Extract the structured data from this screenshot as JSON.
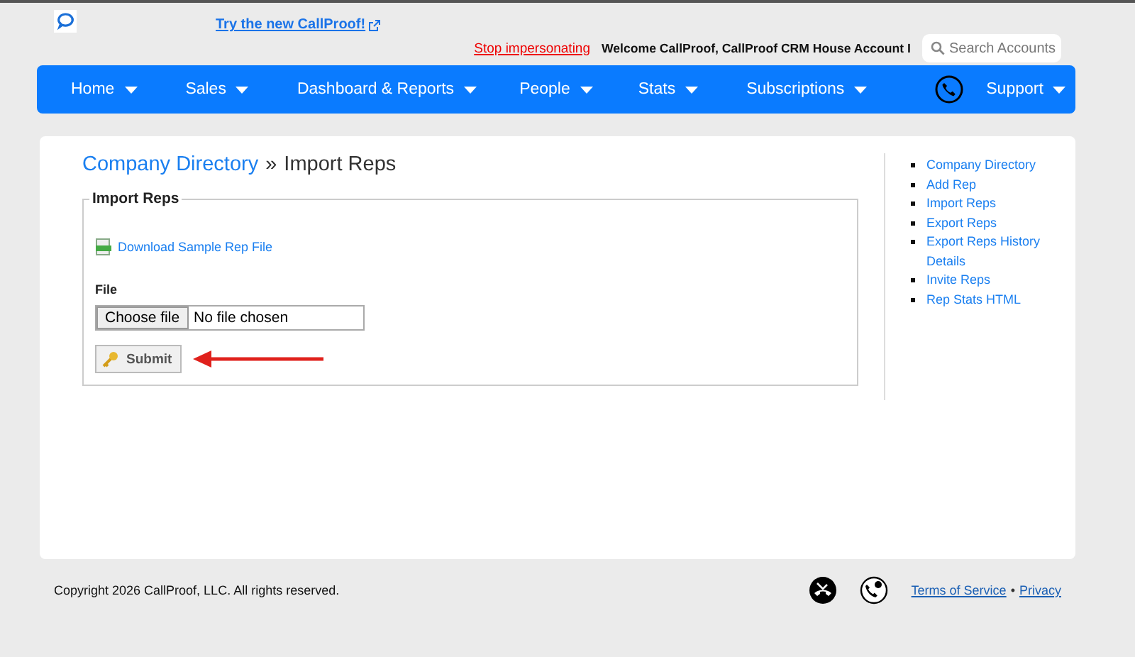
{
  "header": {
    "promo_link": "Try the new CallProof!",
    "stop_link": "Stop impersonating",
    "welcome": "Welcome CallProof, CallProof CRM House Account I",
    "search": {
      "placeholder": "Search Accounts"
    }
  },
  "nav": [
    {
      "label": "Home"
    },
    {
      "label": "Sales"
    },
    {
      "label": "Dashboard & Reports"
    },
    {
      "label": "People"
    },
    {
      "label": "Stats"
    },
    {
      "label": "Subscriptions"
    },
    {
      "label": "Support"
    }
  ],
  "breadcrumb": {
    "parent": "Company Directory",
    "separator": "»",
    "current": "Import Reps"
  },
  "form": {
    "legend": "Import Reps",
    "download_link": "Download Sample Rep File",
    "file_label": "File",
    "choose_button": "Choose file",
    "file_status": "No file chosen",
    "submit": "Submit"
  },
  "sidebar": {
    "items": [
      "Company Directory",
      "Add Rep",
      "Import Reps",
      "Export Reps",
      "Export Reps History Details",
      "Invite Reps",
      "Rep Stats HTML"
    ]
  },
  "footer": {
    "copyright": "Copyright 2026 CallProof, LLC. All rights reserved.",
    "links": [
      "Terms of Service",
      "Privacy"
    ],
    "separator": "•"
  }
}
